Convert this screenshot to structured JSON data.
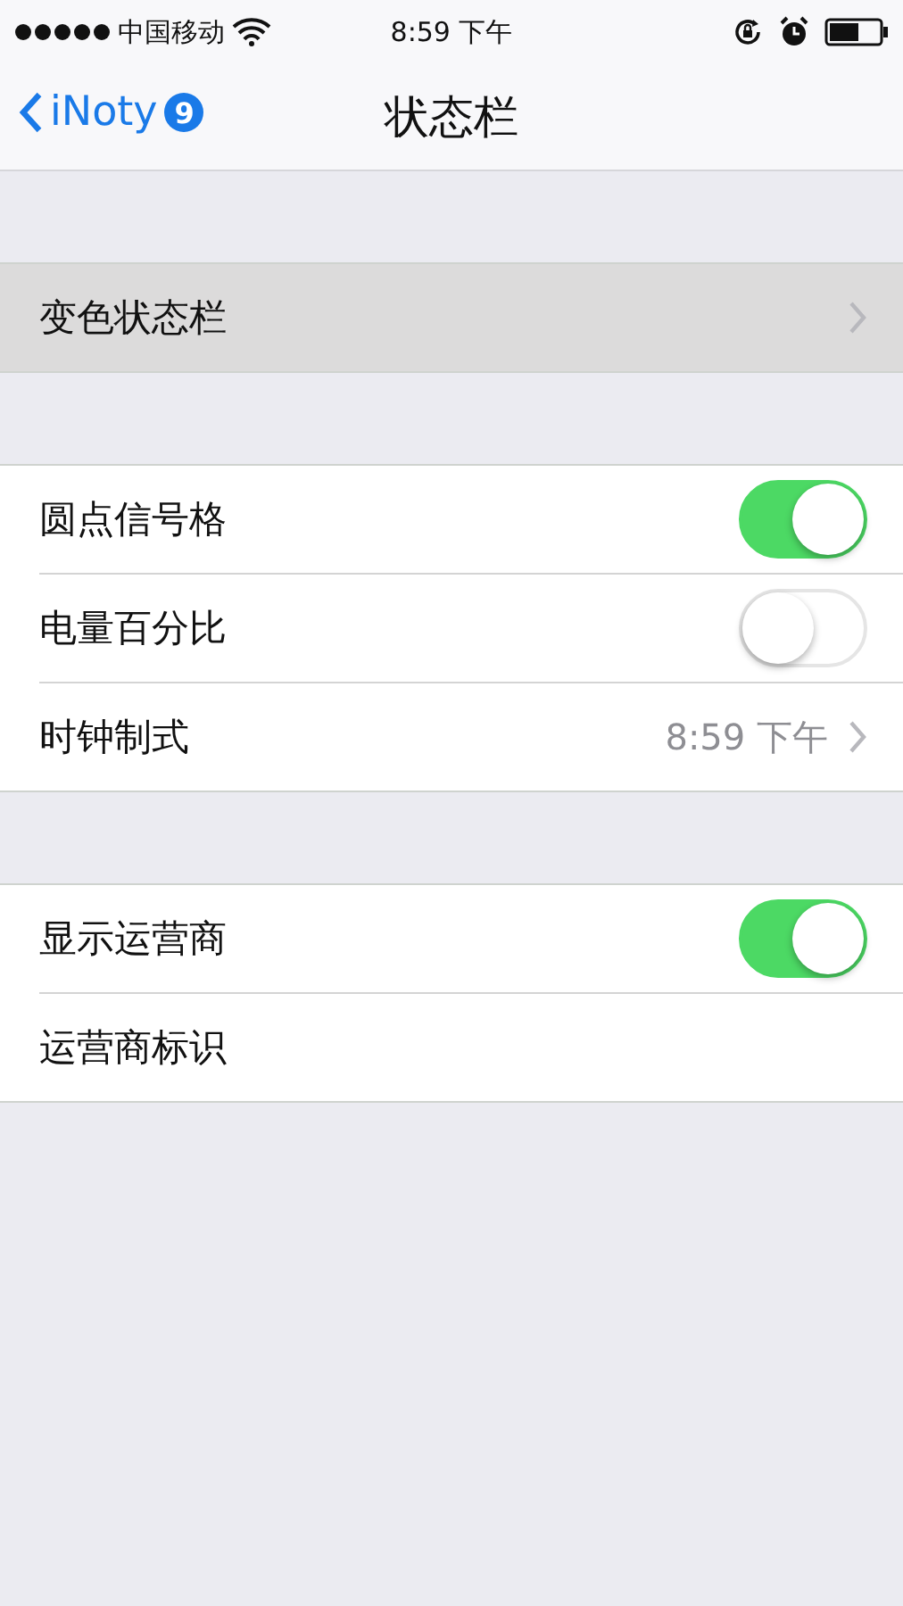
{
  "status_bar": {
    "carrier": "中国移动",
    "time": "8:59 下午"
  },
  "nav_bar": {
    "back": {
      "label": "iNoty",
      "badge": "9"
    },
    "title": "状态栏"
  },
  "sections": [
    {
      "rows": [
        {
          "kind": "link",
          "label": "变色状态栏",
          "highlighted": true
        }
      ]
    },
    {
      "rows": [
        {
          "kind": "toggle",
          "label": "圆点信号格",
          "on": true
        },
        {
          "kind": "toggle",
          "label": "电量百分比",
          "on": false
        },
        {
          "kind": "link",
          "label": "时钟制式",
          "value": "8:59 下午",
          "highlighted": false
        }
      ]
    },
    {
      "rows": [
        {
          "kind": "toggle",
          "label": "显示运营商",
          "on": true
        },
        {
          "kind": "plain",
          "label": "运营商标识"
        }
      ]
    }
  ]
}
